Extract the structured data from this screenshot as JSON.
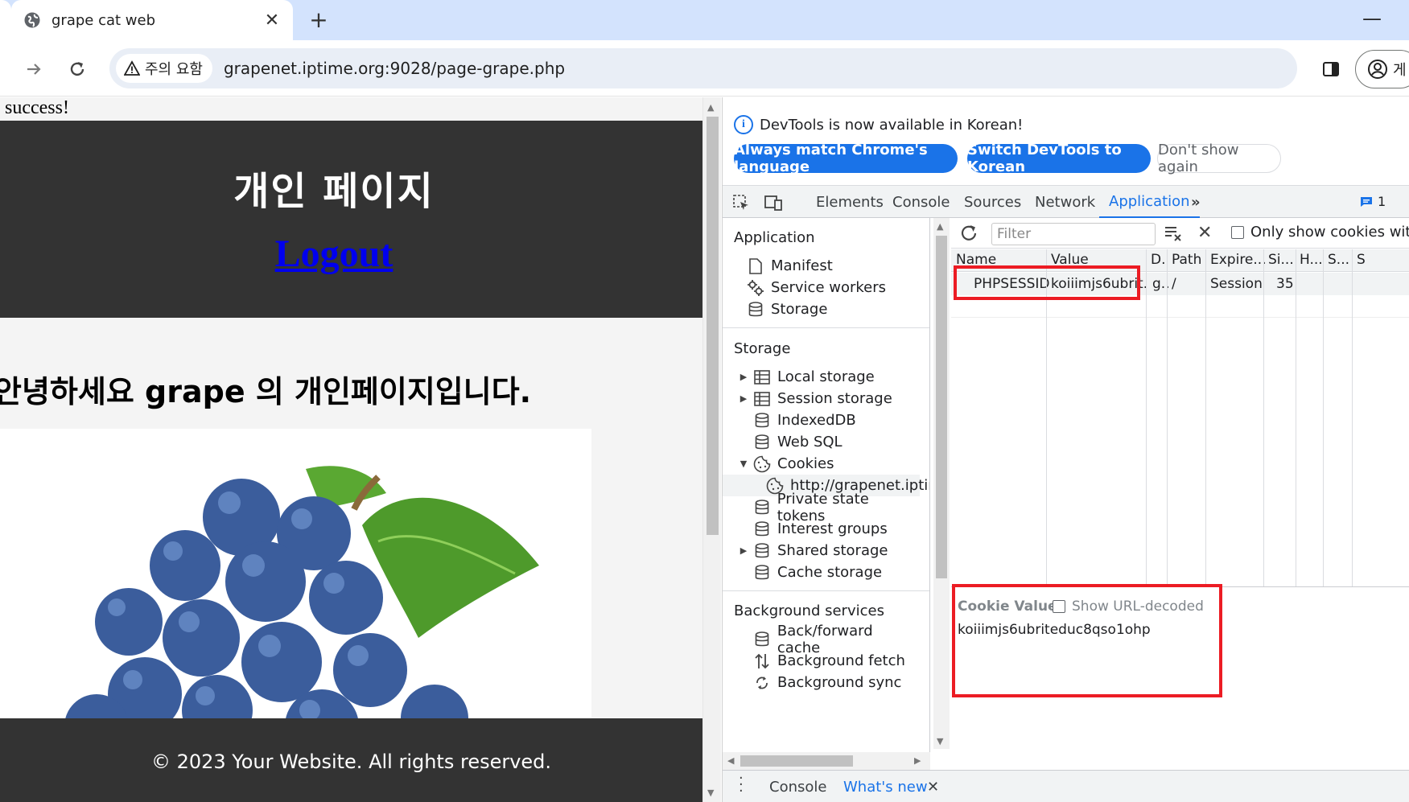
{
  "browser": {
    "tab_title": "grape cat web",
    "url": "grapenet.iptime.org:9028/page-grape.php",
    "security_chip": "주의 요함",
    "profile_label": "게"
  },
  "page": {
    "login_message": "n success!",
    "header_title": "개인 페이지",
    "logout_link": "Logout",
    "greeting": "안녕하세요 grape 의 개인페이지입니다.",
    "footer": "© 2023 Your Website. All rights reserved."
  },
  "devtools": {
    "infobar": {
      "message": "DevTools is now available in Korean!",
      "btn_match": "Always match Chrome's language",
      "btn_switch": "Switch DevTools to Korean",
      "btn_dont_show": "Don't show again"
    },
    "tabs": [
      "Elements",
      "Console",
      "Sources",
      "Network",
      "Application"
    ],
    "issues_count": "1",
    "sidebar": {
      "application_title": "Application",
      "application_items": [
        "Manifest",
        "Service workers",
        "Storage"
      ],
      "storage_title": "Storage",
      "storage_items": [
        "Local storage",
        "Session storage",
        "IndexedDB",
        "Web SQL",
        "Cookies",
        "http://grapenet.iptim",
        "Private state tokens",
        "Interest groups",
        "Shared storage",
        "Cache storage"
      ],
      "background_title": "Background services",
      "background_items": [
        "Back/forward cache",
        "Background fetch",
        "Background sync"
      ]
    },
    "cookies": {
      "filter_placeholder": "Filter",
      "only_show_label": "Only show cookies wit",
      "columns": [
        "Name",
        "Value",
        "D.",
        "Path",
        "Expire...",
        "Si...",
        "H...",
        "S...",
        "S"
      ],
      "row": {
        "name": "PHPSESSID",
        "value": "koiiimjs6ubrit...",
        "domain": "g...",
        "path": "/",
        "expires": "Session",
        "size": "35"
      },
      "cookie_value_label": "Cookie Value",
      "show_url_decoded": "Show URL-decoded",
      "cookie_value": "koiiimjs6ubriteduc8qso1ohp"
    },
    "drawer": {
      "console": "Console",
      "whats_new": "What's new"
    }
  },
  "colors": {
    "accent": "#1a73e8",
    "highlight": "#ec1c24",
    "page_dark": "#333333"
  }
}
